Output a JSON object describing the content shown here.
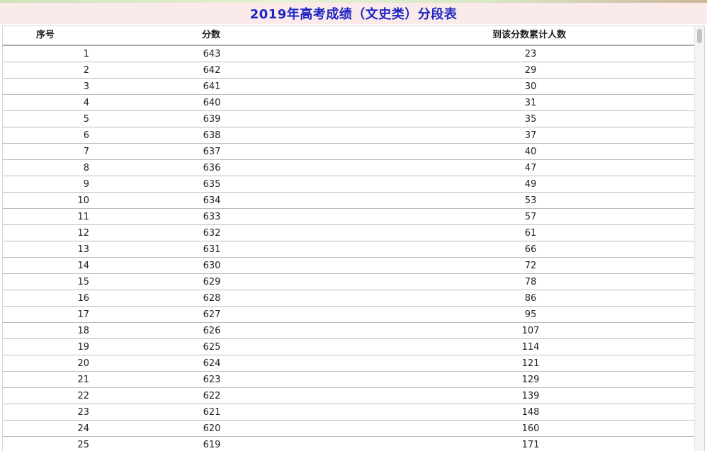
{
  "title": "2019年高考成绩（文史类）分段表",
  "table": {
    "headers": [
      "序号",
      "分数",
      "到该分数累计人数"
    ],
    "rows": [
      [
        "1",
        "643",
        "23"
      ],
      [
        "2",
        "642",
        "29"
      ],
      [
        "3",
        "641",
        "30"
      ],
      [
        "4",
        "640",
        "31"
      ],
      [
        "5",
        "639",
        "35"
      ],
      [
        "6",
        "638",
        "37"
      ],
      [
        "7",
        "637",
        "40"
      ],
      [
        "8",
        "636",
        "47"
      ],
      [
        "9",
        "635",
        "49"
      ],
      [
        "10",
        "634",
        "53"
      ],
      [
        "11",
        "633",
        "57"
      ],
      [
        "12",
        "632",
        "61"
      ],
      [
        "13",
        "631",
        "66"
      ],
      [
        "14",
        "630",
        "72"
      ],
      [
        "15",
        "629",
        "78"
      ],
      [
        "16",
        "628",
        "86"
      ],
      [
        "17",
        "627",
        "95"
      ],
      [
        "18",
        "626",
        "107"
      ],
      [
        "19",
        "625",
        "114"
      ],
      [
        "20",
        "624",
        "121"
      ],
      [
        "21",
        "623",
        "129"
      ],
      [
        "22",
        "622",
        "139"
      ],
      [
        "23",
        "621",
        "148"
      ],
      [
        "24",
        "620",
        "160"
      ],
      [
        "25",
        "619",
        "171"
      ]
    ]
  }
}
